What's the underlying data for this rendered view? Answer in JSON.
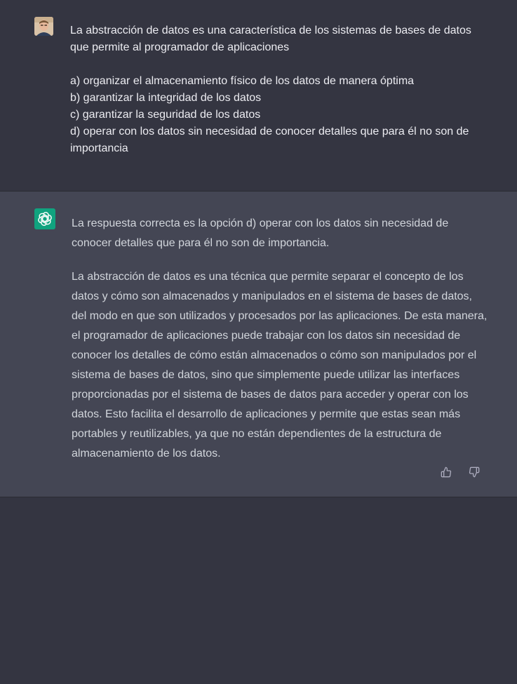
{
  "user_message": {
    "intro": "La abstracción de datos es una característica de los sistemas de bases de datos que permite al programador de aplicaciones",
    "options": [
      "a) organizar el almacenamiento físico de los datos de manera óptima",
      "b) garantizar la integridad de los datos",
      "c) garantizar la seguridad de los datos",
      "d) operar con los datos sin necesidad de conocer detalles que para él no son de importancia"
    ]
  },
  "assistant_message": {
    "paragraphs": [
      "La respuesta correcta es la opción d) operar con los datos sin necesidad de conocer detalles que para él no son de importancia.",
      "La abstracción de datos es una técnica que permite separar el concepto de los datos y cómo son almacenados y manipulados en el sistema de bases de datos, del modo en que son utilizados y procesados por las aplicaciones. De esta manera, el programador de aplicaciones puede trabajar con los datos sin necesidad de conocer los detalles de cómo están almacenados o cómo son manipulados por el sistema de bases de datos, sino que simplemente puede utilizar las interfaces proporcionadas por el sistema de bases de datos para acceder y operar con los datos. Esto facilita el desarrollo de aplicaciones y permite que estas sean más portables y reutilizables, ya que no están dependientes de la estructura de almacenamiento de los datos."
    ]
  },
  "icons": {
    "user_avatar": "user-avatar-photo",
    "assistant_avatar": "openai-logo-icon",
    "thumbs_up": "thumbs-up-icon",
    "thumbs_down": "thumbs-down-icon"
  },
  "colors": {
    "background": "#343541",
    "assistant_row": "#444654",
    "brand": "#10a37f"
  }
}
